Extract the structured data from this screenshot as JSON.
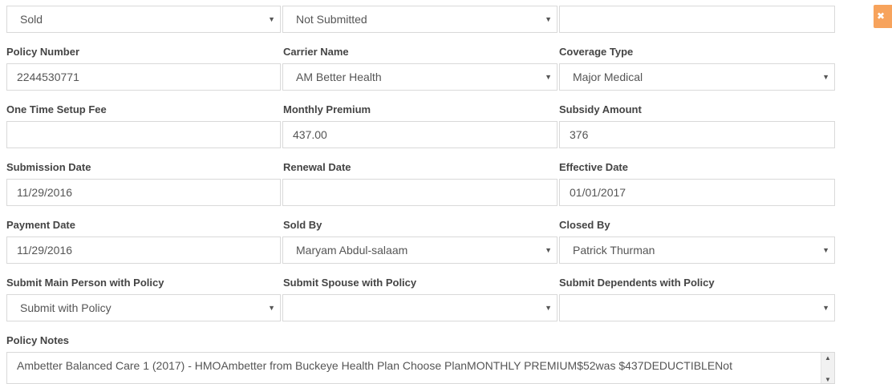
{
  "top_row": {
    "status_value": "Sold",
    "submission_status_value": "Not Submitted",
    "extra_value": ""
  },
  "row1": {
    "policy_number": {
      "label": "Policy Number",
      "value": "2244530771"
    },
    "carrier_name": {
      "label": "Carrier Name",
      "value": "AM Better Health"
    },
    "coverage_type": {
      "label": "Coverage Type",
      "value": "Major Medical"
    }
  },
  "row2": {
    "setup_fee": {
      "label": "One Time Setup Fee",
      "value": ""
    },
    "monthly_premium": {
      "label": "Monthly Premium",
      "value": "437.00"
    },
    "subsidy_amount": {
      "label": "Subsidy Amount",
      "value": "376"
    }
  },
  "row3": {
    "submission_date": {
      "label": "Submission Date",
      "value": "11/29/2016"
    },
    "renewal_date": {
      "label": "Renewal Date",
      "value": ""
    },
    "effective_date": {
      "label": "Effective Date",
      "value": "01/01/2017"
    }
  },
  "row4": {
    "payment_date": {
      "label": "Payment Date",
      "value": "11/29/2016"
    },
    "sold_by": {
      "label": "Sold By",
      "value": "Maryam Abdul-salaam"
    },
    "closed_by": {
      "label": "Closed By",
      "value": "Patrick Thurman"
    }
  },
  "row5": {
    "submit_main": {
      "label": "Submit Main Person with Policy",
      "value": "Submit with Policy"
    },
    "submit_spouse": {
      "label": "Submit Spouse with Policy",
      "value": ""
    },
    "submit_dependents": {
      "label": "Submit Dependents with Policy",
      "value": ""
    }
  },
  "notes": {
    "label": "Policy Notes",
    "value": "Ambetter Balanced Care 1 (2017) - HMOAmbetter from Buckeye Health Plan Choose PlanMONTHLY PREMIUM$52was $437DEDUCTIBLENot"
  },
  "icons": {
    "caret": "▼",
    "close": "✖",
    "scroll_up": "▲",
    "scroll_down": "▼"
  },
  "colors": {
    "close_button": "#f7a35c",
    "border": "#d9d9d9",
    "label": "#444444"
  }
}
